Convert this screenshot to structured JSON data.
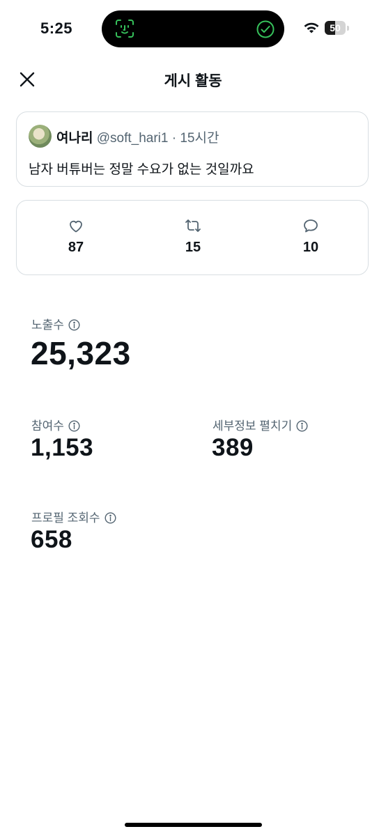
{
  "status_bar": {
    "time": "5:25",
    "battery": "50",
    "battery_level": 0.5
  },
  "header": {
    "title": "게시 활동"
  },
  "tweet": {
    "author_name": "여나리",
    "handle": "@soft_hari1",
    "separator": "·",
    "time": "15시간",
    "text": "남자 버튜버는 정말 수요가 없는 것일까요"
  },
  "engagement": {
    "likes": "87",
    "retweets": "15",
    "replies": "10"
  },
  "metrics": {
    "impressions": {
      "label": "노출수",
      "value": "25,323"
    },
    "engagements": {
      "label": "참여수",
      "value": "1,153"
    },
    "detail_expands": {
      "label": "세부정보 펼치기",
      "value": "389"
    },
    "profile_visits": {
      "label": "프로필 조회수",
      "value": "658"
    }
  },
  "colors": {
    "text": "#0f1419",
    "secondary": "#536471",
    "border": "#d8dee2",
    "island_check": "#36c15b"
  }
}
